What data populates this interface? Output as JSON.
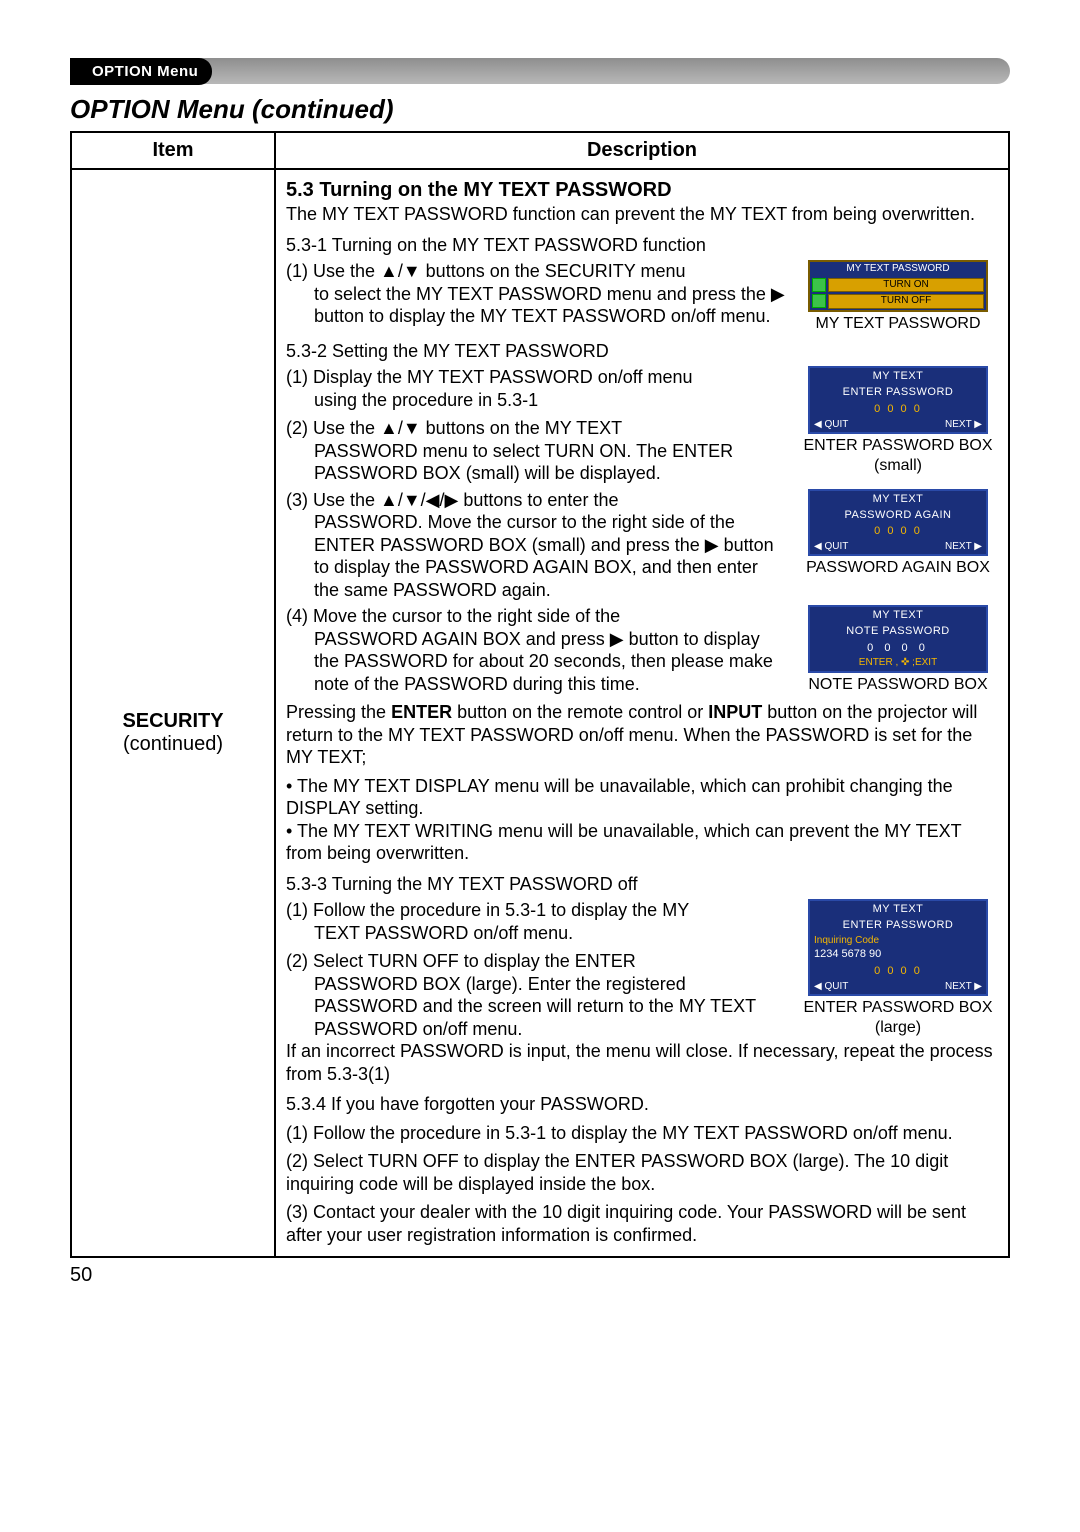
{
  "tab": "OPTION Menu",
  "page_title": "OPTION Menu (continued)",
  "headers": {
    "item": "Item",
    "desc": "Description"
  },
  "item": {
    "name": "SECURITY",
    "sub": "(continued)"
  },
  "s": {
    "h53": "5.3 Turning on the MY TEXT PASSWORD",
    "p53": "The MY TEXT PASSWORD function can prevent the MY TEXT from being overwritten.",
    "h531": "5.3-1 Turning on the MY TEXT PASSWORD function",
    "p531_1a": "(1) Use the ▲/▼ buttons on the SECURITY menu",
    "p531_1b": "to select the MY TEXT PASSWORD menu and press the ▶ button to display the MY TEXT PASSWORD on/off menu.",
    "h532": "5.3-2 Setting the MY TEXT PASSWORD",
    "p532_1a": "(1) Display the MY TEXT PASSWORD on/off menu",
    "p532_1b": "using the procedure in 5.3-1",
    "p532_2a": "(2) Use the ▲/▼ buttons on the MY TEXT",
    "p532_2b": "PASSWORD menu to select TURN ON. The ENTER PASSWORD BOX (small) will be displayed.",
    "p532_3a": "(3) Use the ▲/▼/◀/▶ buttons to enter the",
    "p532_3b": "PASSWORD. Move the cursor to the right side of the ENTER PASSWORD BOX (small) and press the ▶ button to display the PASSWORD AGAIN BOX, and then enter the same PASSWORD again.",
    "p532_4a": "(4) Move the cursor to the right side of the",
    "p532_4b": "PASSWORD AGAIN BOX and press ▶ button to display the PASSWORD for about 20 seconds, then please make note of the PASSWORD during this time.",
    "p532_5": "Pressing the ENTER button on the remote control or INPUT button on the projector will return to the MY TEXT PASSWORD on/off menu. When the PASSWORD is set for the MY TEXT;",
    "bul1": "• The MY TEXT DISPLAY menu will be unavailable, which can prohibit changing the DISPLAY setting.",
    "bul2": "• The MY TEXT WRITING menu will be unavailable, which can prevent the MY TEXT from being overwritten.",
    "h533": "5.3-3 Turning the MY TEXT PASSWORD off",
    "p533_1a": "(1) Follow the procedure in 5.3-1 to display the MY",
    "p533_1b": "TEXT PASSWORD on/off menu.",
    "p533_2a": "(2) Select TURN OFF to display the ENTER",
    "p533_2b": "PASSWORD BOX (large). Enter the registered PASSWORD and the screen will return to the MY TEXT PASSWORD on/off menu.",
    "p533_err": "If an incorrect PASSWORD is input, the menu will close. If necessary, repeat the process from 5.3-3(1)",
    "h534": "5.3.4 If you have forgotten your PASSWORD.",
    "p534_1": "(1) Follow the procedure in 5.3-1 to display the MY TEXT PASSWORD on/off menu.",
    "p534_2": "(2) Select TURN OFF to display the ENTER PASSWORD BOX (large). The 10 digit inquiring code will be displayed inside the box.",
    "p534_3": "(3) Contact your dealer with the 10 digit inquiring code. Your PASSWORD will be sent after your user registration information is confirmed."
  },
  "fig": {
    "menu_title": "MY TEXT PASSWORD",
    "turn_on": "TURN ON",
    "turn_off": "TURN OFF",
    "cap_menu": "MY TEXT PASSWORD",
    "mt": "MY TEXT",
    "enter_pw": "ENTER PASSWORD",
    "pin": "0 0 0 0",
    "quit": "QUIT",
    "next": "NEXT",
    "cap_enter_small": "ENTER PASSWORD BOX (small)",
    "pw_again": "PASSWORD AGAIN",
    "cap_again": "PASSWORD AGAIN BOX",
    "note_pw": "NOTE PASSWORD",
    "note_pin": "0 0 0 0",
    "enter_exit": "ENTER , ✜ ;EXIT",
    "cap_note": "NOTE PASSWORD BOX",
    "inq_label": "Inquiring Code",
    "inq_code": "1234 5678 90",
    "cap_enter_large": "ENTER PASSWORD BOX (large)"
  },
  "page_number": "50"
}
